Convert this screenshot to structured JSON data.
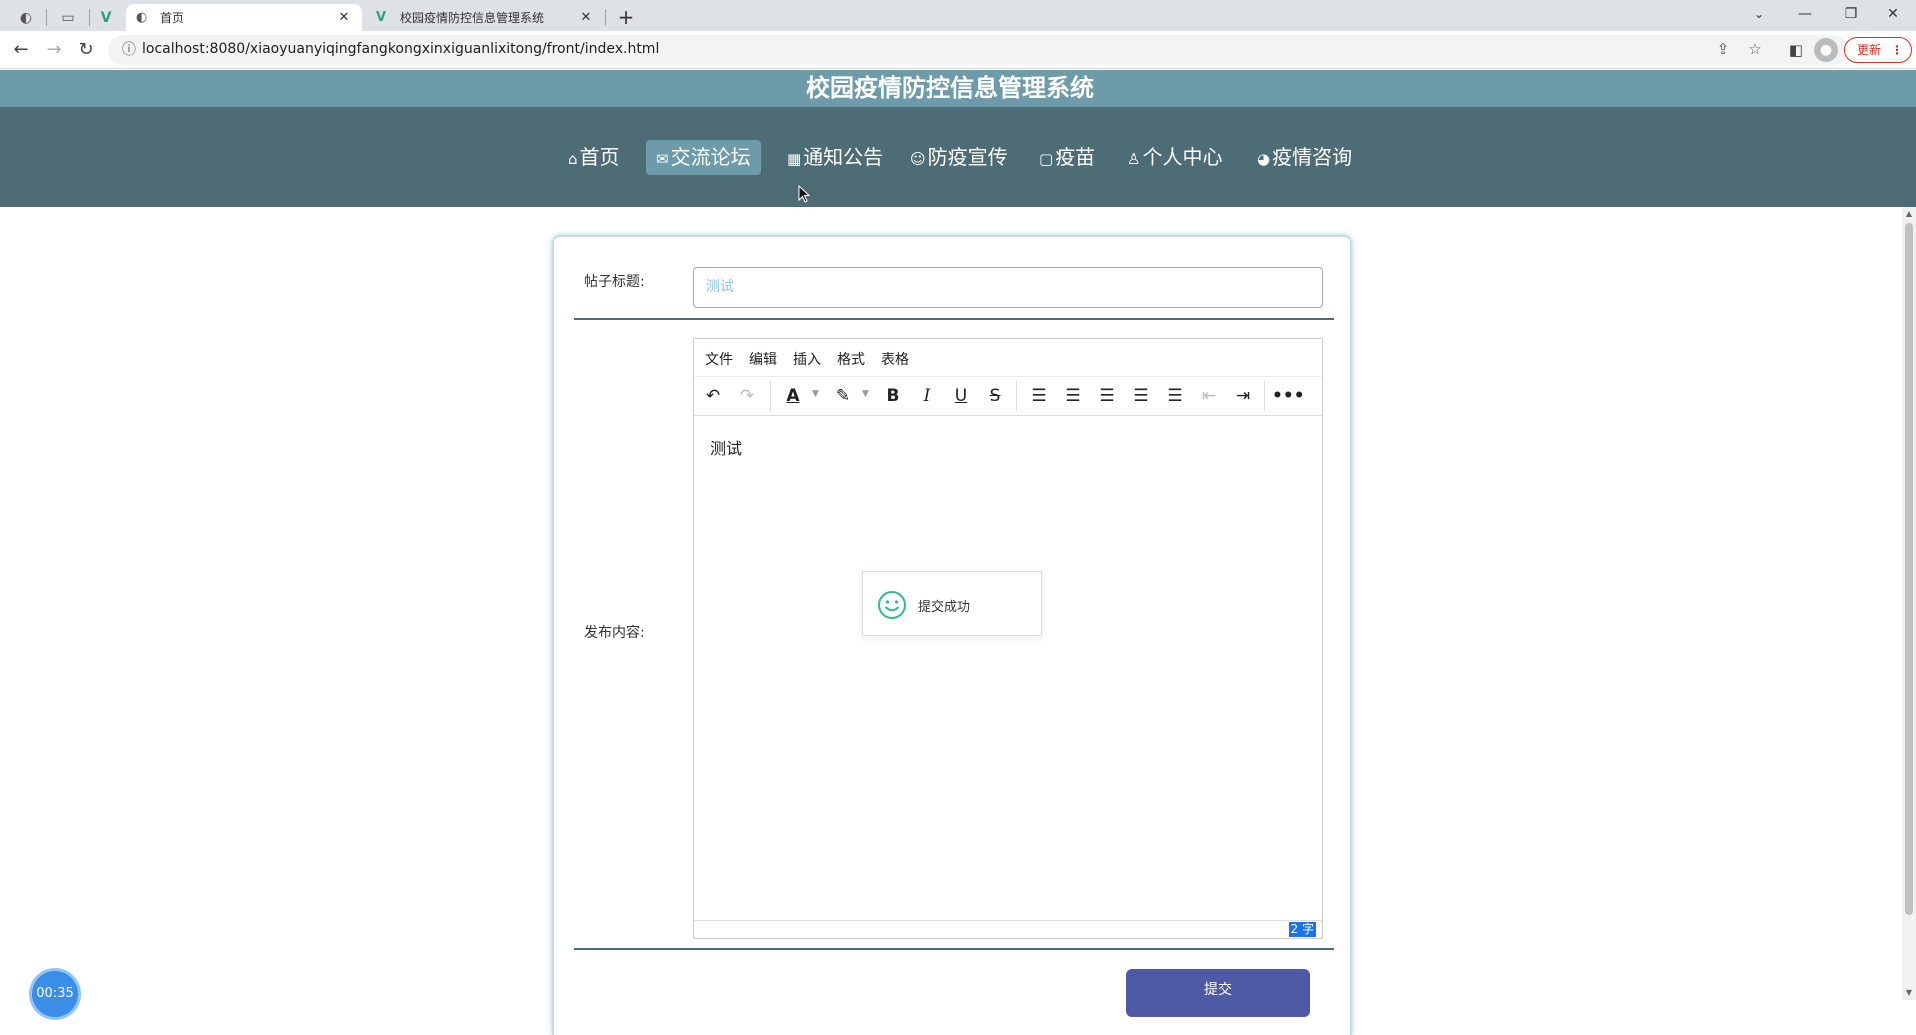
{
  "browser": {
    "tabs": [
      {
        "title": "首页",
        "active": true
      },
      {
        "title": "校园疫情防控信息管理系统",
        "active": false
      }
    ],
    "url": "localhost:8080/xiaoyuanyiqingfangkongxinxiguanlixitong/front/index.html",
    "update_label": "更新",
    "window_controls": {
      "minimize": "—",
      "restore": "❐",
      "close": "✕"
    }
  },
  "site": {
    "title": "校园疫情防控信息管理系统",
    "nav": [
      {
        "icon": "home-icon",
        "glyph": "⌂",
        "label": "首页"
      },
      {
        "icon": "mail-icon",
        "glyph": "✉",
        "label": "交流论坛",
        "active": true
      },
      {
        "icon": "notice-icon",
        "glyph": "▦",
        "label": "通知公告"
      },
      {
        "icon": "shield-icon",
        "glyph": "☺",
        "label": "防疫宣传"
      },
      {
        "icon": "vaccine-icon",
        "glyph": "▢",
        "label": "疫苗"
      },
      {
        "icon": "user-icon",
        "glyph": "♙",
        "label": "个人中心"
      },
      {
        "icon": "consult-icon",
        "glyph": "◕",
        "label": "疫情咨询"
      }
    ]
  },
  "form": {
    "title_label": "帖子标题:",
    "title_value": "测试",
    "content_label": "发布内容:",
    "submit_label": "提交"
  },
  "editor": {
    "menu": [
      "文件",
      "编辑",
      "插入",
      "格式",
      "表格"
    ],
    "content": "测试",
    "wordcount": "2 字"
  },
  "toast": {
    "message": "提交成功"
  },
  "timer": {
    "value": "00:35"
  },
  "colors": {
    "header": "#6d9ba9",
    "nav": "#4e6c76",
    "submit": "#4f5aa7"
  }
}
